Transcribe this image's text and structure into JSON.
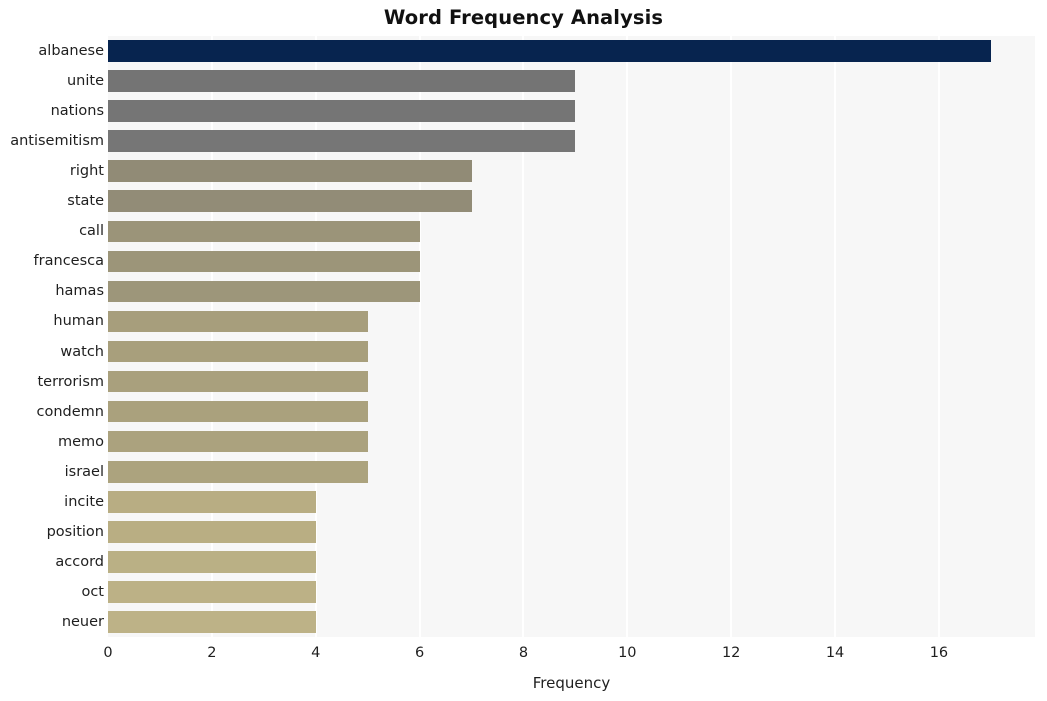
{
  "chart_data": {
    "type": "bar",
    "orientation": "horizontal",
    "title": "Word Frequency Analysis",
    "xlabel": "Frequency",
    "ylabel": "",
    "categories": [
      "albanese",
      "unite",
      "nations",
      "antisemitism",
      "right",
      "state",
      "call",
      "francesca",
      "hamas",
      "human",
      "watch",
      "terrorism",
      "condemn",
      "memo",
      "israel",
      "incite",
      "position",
      "accord",
      "oct",
      "neuer"
    ],
    "values": [
      17,
      9,
      9,
      9,
      7,
      7,
      6,
      6,
      6,
      5,
      5,
      5,
      5,
      5,
      5,
      4,
      4,
      4,
      4,
      4
    ],
    "bar_colors": [
      "#07244f",
      "#747474",
      "#757575",
      "#767676",
      "#918b76",
      "#928c77",
      "#9b9479",
      "#9c9579",
      "#9d967a",
      "#a79e7c",
      "#a89f7c",
      "#a9a07d",
      "#aaa17d",
      "#aba27e",
      "#aca37e",
      "#b8ad83",
      "#b9ae83",
      "#bab085",
      "#bcb186",
      "#bdb287"
    ],
    "xlim": [
      0,
      17.85
    ],
    "xticks": [
      0,
      2,
      4,
      6,
      8,
      10,
      12,
      14,
      16
    ],
    "xticklabels": [
      "0",
      "2",
      "4",
      "6",
      "8",
      "10",
      "12",
      "14",
      "16"
    ],
    "grid": "vertical-only",
    "grid_color": "#ffffff",
    "plot_background": "#f7f7f7",
    "figure_background": "#ffffff",
    "legend": "none"
  }
}
